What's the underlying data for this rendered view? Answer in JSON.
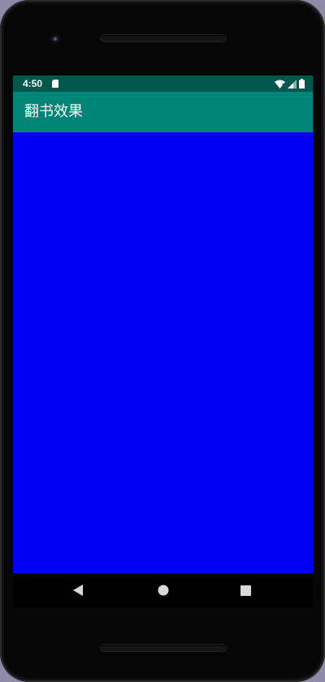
{
  "status_bar": {
    "time": "4:50",
    "icons": [
      "sd-card-icon",
      "wifi-icon",
      "signal-icon",
      "battery-icon"
    ]
  },
  "app_bar": {
    "title": "翻书效果"
  },
  "navigation": {
    "buttons": [
      "back-icon",
      "home-icon",
      "recents-icon"
    ]
  },
  "colors": {
    "status_bar": "#00574B",
    "app_bar": "#008577",
    "content": "#0000F5",
    "device_body": "#060606"
  }
}
